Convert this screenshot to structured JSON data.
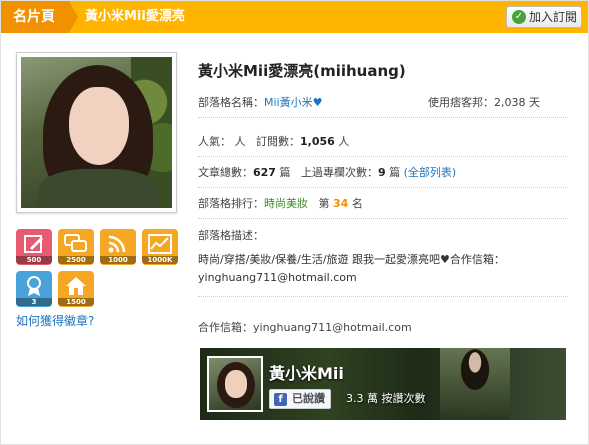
{
  "topbar": {
    "home_tab": "名片頁",
    "crumb": "黃小米Mii愛漂亮",
    "subscribe_button": "加入訂閱"
  },
  "profile": {
    "name": "黃小米Mii愛漂亮(miihuang)",
    "blog_name_label": "部落格名稱：",
    "blog_name": "Mii黃小米",
    "heart": "♥",
    "days_label": "使用痞客邦：",
    "days_value": "2,038 天",
    "popularity_label": "人氣：",
    "popularity_value": "人",
    "subs_label": "訂閱數：",
    "subs_value": "1,056",
    "subs_unit": "人",
    "articles_label": "文章總數：",
    "articles_value": "627",
    "articles_unit": "篇",
    "featured_label": "上過專欄次數：",
    "featured_value": "9",
    "featured_unit": "篇",
    "featured_link": "(全部列表)",
    "rank_label": "部落格排行：",
    "rank_category": "時尚美妝",
    "rank_prefix": "第",
    "rank_value": "34",
    "rank_suffix": "名",
    "desc_label": "部落格描述：",
    "desc_text": "時尚/穿搭/美妝/保養/生活/旅遊 跟我一起愛漂亮吧♥合作信箱：yinghuang711@hotmail.com",
    "mail_label": "合作信箱：",
    "mail_value": "yinghuang711@hotmail.com"
  },
  "badges": [
    {
      "icon": "edit-icon",
      "count": "500",
      "color": "#e85a6f"
    },
    {
      "icon": "comments-icon",
      "count": "2500",
      "color": "#f5a623"
    },
    {
      "icon": "rss-icon",
      "count": "1000",
      "color": "#f5a623"
    },
    {
      "icon": "chart-icon",
      "count": "1000K",
      "color": "#f5a623"
    },
    {
      "icon": "award-icon",
      "count": "3",
      "color": "#4aa3d8"
    },
    {
      "icon": "home-icon",
      "count": "1500",
      "color": "#f5a623"
    }
  ],
  "how_link": "如何獲得徽章?",
  "fb": {
    "name": "黃小米Mii",
    "like_label": "已說讚",
    "count_text": "3.3 萬 按讚次數"
  }
}
